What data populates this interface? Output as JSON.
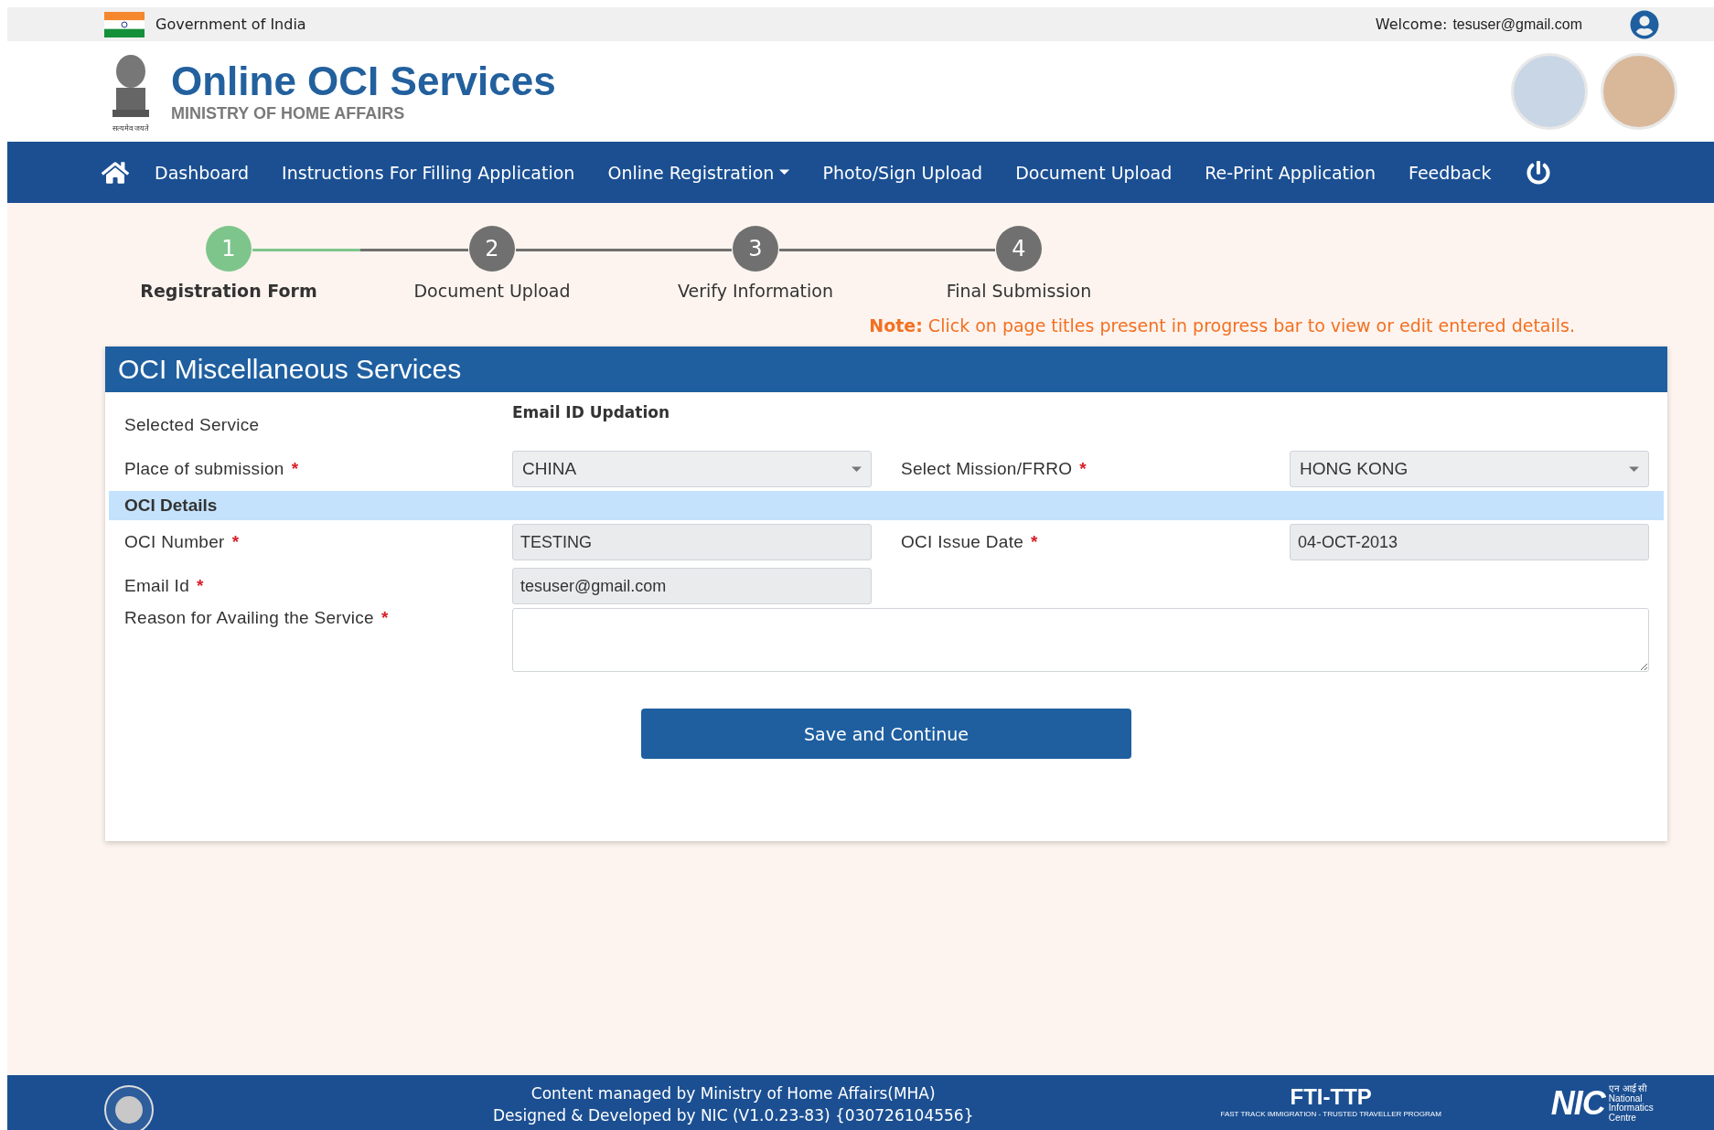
{
  "top_bar": {
    "title": "Government of India",
    "welcome_label": "Welcome:",
    "user": "tesuser@gmail.com"
  },
  "header": {
    "title": "Online OCI Services",
    "subtitle": "MINISTRY OF HOME AFFAIRS",
    "emblem_motto": "सत्यमेव जयते"
  },
  "nav": [
    {
      "label": "Dashboard",
      "dropdown": false
    },
    {
      "label": "Instructions For Filling Application",
      "dropdown": false
    },
    {
      "label": "Online Registration",
      "dropdown": true
    },
    {
      "label": "Photo/Sign Upload",
      "dropdown": false
    },
    {
      "label": "Document Upload",
      "dropdown": false
    },
    {
      "label": "Re-Print Application",
      "dropdown": false
    },
    {
      "label": "Feedback",
      "dropdown": false
    }
  ],
  "steps": [
    {
      "number": "1",
      "label": "Registration Form",
      "selected": true
    },
    {
      "number": "2",
      "label": "Document Upload",
      "selected": false
    },
    {
      "number": "3",
      "label": "Verify Information",
      "selected": false
    },
    {
      "number": "4",
      "label": "Final Submission",
      "selected": false
    }
  ],
  "note": {
    "label": "Note:",
    "text": "Click on page titles present in progress bar to view or edit entered details."
  },
  "panel": {
    "title": "OCI Miscellaneous Services",
    "rows": [
      {
        "kind": "pair",
        "fields": [
          {
            "label": "Selected Service",
            "kind": "static",
            "value": "Email ID Updation"
          }
        ]
      },
      {
        "kind": "pair",
        "fields": [
          {
            "label": "Place of submission",
            "mark": "*",
            "kind": "select",
            "value": "CHINA"
          },
          {
            "label": "Select Mission/FRRO",
            "mark": "*",
            "kind": "select",
            "value": "HONG KONG"
          }
        ]
      },
      {
        "kind": "section",
        "title": "OCI Details"
      },
      {
        "kind": "pair",
        "fields": [
          {
            "label": "OCI Number",
            "mark": "*",
            "kind": "text",
            "value": "TESTING"
          },
          {
            "label": "OCI Issue Date",
            "mark": "*",
            "kind": "text",
            "value": "04-OCT-2013"
          }
        ]
      },
      {
        "kind": "pair",
        "fields": [
          {
            "label": "Email Id",
            "mark": "*",
            "kind": "text",
            "value": "tesuser@gmail.com"
          }
        ]
      },
      {
        "kind": "wide",
        "fields": [
          {
            "label": "Reason for Availing the Service",
            "mark": "*",
            "kind": "textarea"
          }
        ]
      }
    ],
    "button": "Save and Continue"
  },
  "footer": {
    "lines": [
      "Content managed by Ministry of Home Affairs(MHA)",
      "Designed & Developed by NIC (V1.0.23-83) {030726104556}"
    ],
    "fti_logo": "FTI-TTP",
    "fti_tagline": "FAST TRACK IMMIGRATION - TRUSTED TRAVELLER PROGRAM",
    "nic_logo": "NIC",
    "nic_hindi": "एन आई सी",
    "nic_name": [
      "National",
      "Informatics",
      "Centre"
    ]
  }
}
